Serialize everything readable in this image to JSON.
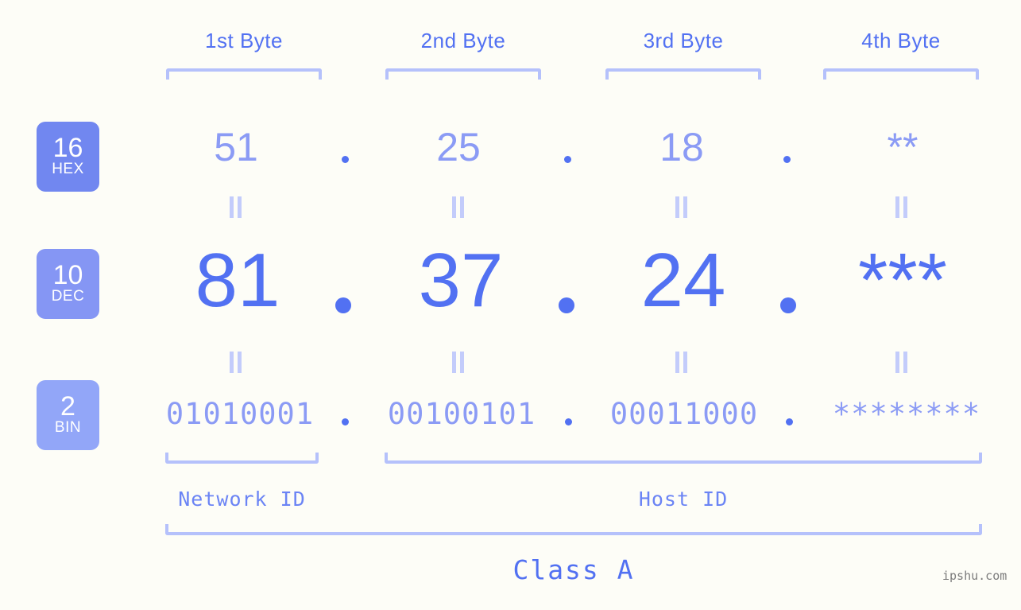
{
  "theme": {
    "background": "#fdfdf7",
    "accent_strong": "#5271f2",
    "accent_mid": "#8b9bf5",
    "accent_light": "#b5c1fb",
    "badge_hex_bg": "#7187f0",
    "badge_dec_bg": "#8596f4",
    "badge_bin_bg": "#92a6f8",
    "watermark_color": "#7c7c7c"
  },
  "byte_headers": [
    {
      "label": "1st Byte"
    },
    {
      "label": "2nd Byte"
    },
    {
      "label": "3rd Byte"
    },
    {
      "label": "4th Byte"
    }
  ],
  "rows": [
    {
      "base": "16",
      "base_name": "HEX",
      "values": [
        "51",
        "25",
        "18",
        "**"
      ],
      "separator": "."
    },
    {
      "base": "10",
      "base_name": "DEC",
      "values": [
        "81",
        "37",
        "24",
        "***"
      ],
      "separator": "."
    },
    {
      "base": "2",
      "base_name": "BIN",
      "values": [
        "01010001",
        "00100101",
        "00011000",
        "********"
      ],
      "separator": "."
    }
  ],
  "equals_marks": {
    "glyph": "=",
    "count_per_gap": 4
  },
  "segments": {
    "network_id": "Network ID",
    "host_id": "Host ID"
  },
  "class_label": "Class A",
  "watermark": "ipshu.com"
}
